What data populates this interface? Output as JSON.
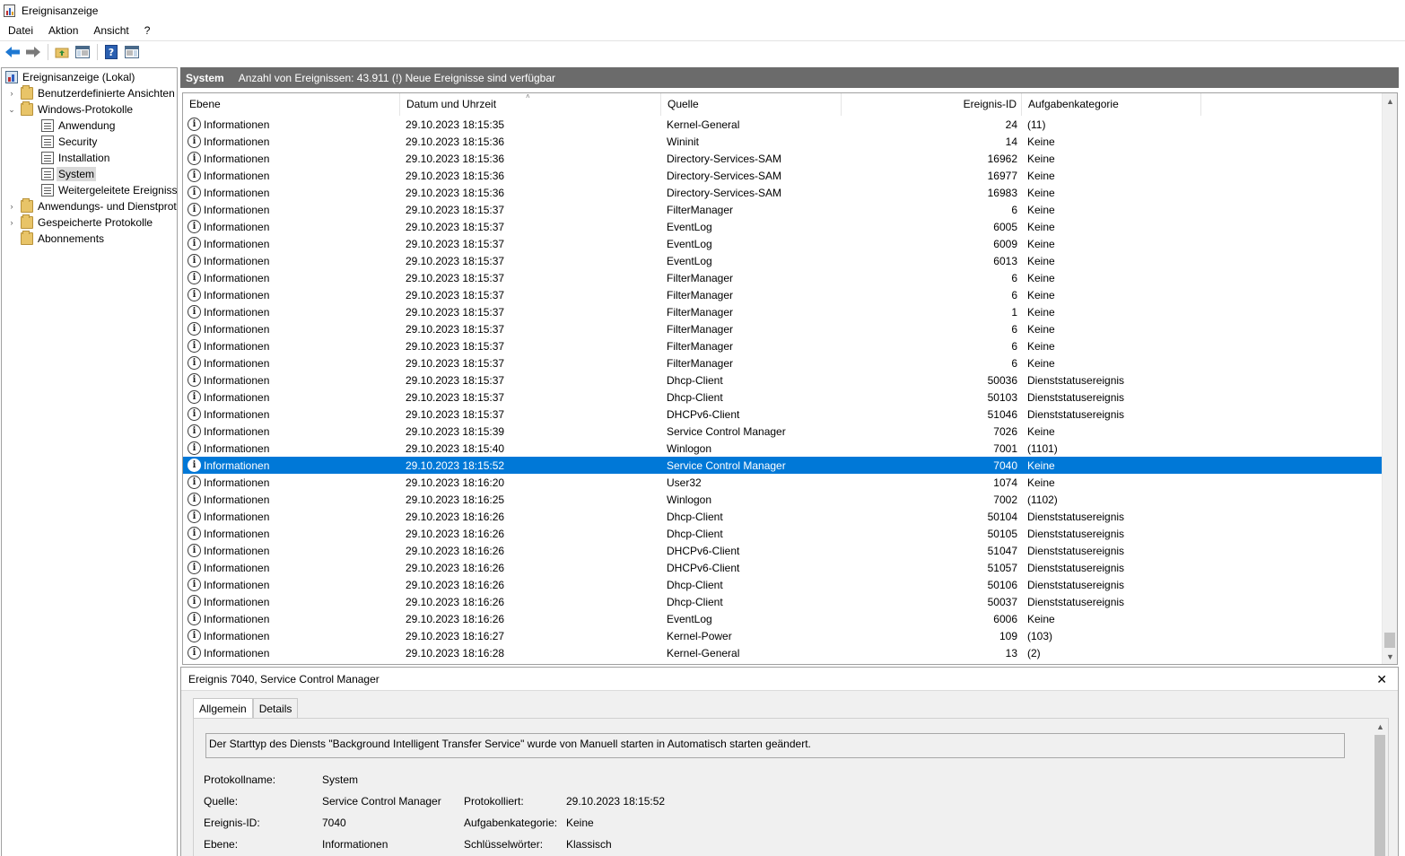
{
  "window": {
    "title": "Ereignisanzeige"
  },
  "menu": [
    {
      "id": "datei",
      "label": "Datei"
    },
    {
      "id": "aktion",
      "label": "Aktion"
    },
    {
      "id": "ansicht",
      "label": "Ansicht"
    },
    {
      "id": "hilfe",
      "label": "?"
    }
  ],
  "toolbar": {
    "buttons": [
      "back-arrow-icon",
      "forward-arrow-icon",
      "folder-up-icon",
      "show-hide-console-tree-icon",
      "help-icon",
      "action-pane-icon"
    ]
  },
  "tree": [
    {
      "label": "Ereignisanzeige (Lokal)",
      "icon": "event-viewer-icon",
      "level": 0,
      "expander": "",
      "selected": false
    },
    {
      "label": "Benutzerdefinierte Ansichten",
      "icon": "folder-icon",
      "level": 1,
      "expander": "collapsed",
      "selected": false
    },
    {
      "label": "Windows-Protokolle",
      "icon": "folder-icon",
      "level": 1,
      "expander": "expanded",
      "selected": false
    },
    {
      "label": "Anwendung",
      "icon": "log-icon",
      "level": 2,
      "expander": "",
      "selected": false
    },
    {
      "label": "Security",
      "icon": "log-icon",
      "level": 2,
      "expander": "",
      "selected": false
    },
    {
      "label": "Installation",
      "icon": "log-icon",
      "level": 2,
      "expander": "",
      "selected": false
    },
    {
      "label": "System",
      "icon": "log-icon",
      "level": 2,
      "expander": "",
      "selected": true
    },
    {
      "label": "Weitergeleitete Ereignisse",
      "icon": "log-icon",
      "level": 2,
      "expander": "",
      "selected": false
    },
    {
      "label": "Anwendungs- und Dienstprotokolle",
      "icon": "folder-icon",
      "level": 1,
      "expander": "collapsed",
      "selected": false
    },
    {
      "label": "Gespeicherte Protokolle",
      "icon": "folder-icon",
      "level": 1,
      "expander": "collapsed",
      "selected": false
    },
    {
      "label": "Abonnements",
      "icon": "folder-icon",
      "level": 1,
      "expander": "",
      "selected": false
    }
  ],
  "main": {
    "log_name": "System",
    "count_text": "Anzahl von Ereignissen: 43.911 (!) Neue Ereignisse sind verfügbar"
  },
  "grid": {
    "columns": [
      "Ebene",
      "Datum und Uhrzeit",
      "Quelle",
      "Ereignis-ID",
      "Aufgabenkategorie"
    ],
    "rows": [
      {
        "level": "Informationen",
        "date": "29.10.2023 18:15:35",
        "source": "Kernel-General",
        "id": "24",
        "category": "(11)"
      },
      {
        "level": "Informationen",
        "date": "29.10.2023 18:15:36",
        "source": "Wininit",
        "id": "14",
        "category": "Keine"
      },
      {
        "level": "Informationen",
        "date": "29.10.2023 18:15:36",
        "source": "Directory-Services-SAM",
        "id": "16962",
        "category": "Keine"
      },
      {
        "level": "Informationen",
        "date": "29.10.2023 18:15:36",
        "source": "Directory-Services-SAM",
        "id": "16977",
        "category": "Keine"
      },
      {
        "level": "Informationen",
        "date": "29.10.2023 18:15:36",
        "source": "Directory-Services-SAM",
        "id": "16983",
        "category": "Keine"
      },
      {
        "level": "Informationen",
        "date": "29.10.2023 18:15:37",
        "source": "FilterManager",
        "id": "6",
        "category": "Keine"
      },
      {
        "level": "Informationen",
        "date": "29.10.2023 18:15:37",
        "source": "EventLog",
        "id": "6005",
        "category": "Keine"
      },
      {
        "level": "Informationen",
        "date": "29.10.2023 18:15:37",
        "source": "EventLog",
        "id": "6009",
        "category": "Keine"
      },
      {
        "level": "Informationen",
        "date": "29.10.2023 18:15:37",
        "source": "EventLog",
        "id": "6013",
        "category": "Keine"
      },
      {
        "level": "Informationen",
        "date": "29.10.2023 18:15:37",
        "source": "FilterManager",
        "id": "6",
        "category": "Keine"
      },
      {
        "level": "Informationen",
        "date": "29.10.2023 18:15:37",
        "source": "FilterManager",
        "id": "6",
        "category": "Keine"
      },
      {
        "level": "Informationen",
        "date": "29.10.2023 18:15:37",
        "source": "FilterManager",
        "id": "1",
        "category": "Keine"
      },
      {
        "level": "Informationen",
        "date": "29.10.2023 18:15:37",
        "source": "FilterManager",
        "id": "6",
        "category": "Keine"
      },
      {
        "level": "Informationen",
        "date": "29.10.2023 18:15:37",
        "source": "FilterManager",
        "id": "6",
        "category": "Keine"
      },
      {
        "level": "Informationen",
        "date": "29.10.2023 18:15:37",
        "source": "FilterManager",
        "id": "6",
        "category": "Keine"
      },
      {
        "level": "Informationen",
        "date": "29.10.2023 18:15:37",
        "source": "Dhcp-Client",
        "id": "50036",
        "category": "Dienststatusereignis"
      },
      {
        "level": "Informationen",
        "date": "29.10.2023 18:15:37",
        "source": "Dhcp-Client",
        "id": "50103",
        "category": "Dienststatusereignis"
      },
      {
        "level": "Informationen",
        "date": "29.10.2023 18:15:37",
        "source": "DHCPv6-Client",
        "id": "51046",
        "category": "Dienststatusereignis"
      },
      {
        "level": "Informationen",
        "date": "29.10.2023 18:15:39",
        "source": "Service Control Manager",
        "id": "7026",
        "category": "Keine"
      },
      {
        "level": "Informationen",
        "date": "29.10.2023 18:15:40",
        "source": "Winlogon",
        "id": "7001",
        "category": "(1101)"
      },
      {
        "level": "Informationen",
        "date": "29.10.2023 18:15:52",
        "source": "Service Control Manager",
        "id": "7040",
        "category": "Keine",
        "selected": true
      },
      {
        "level": "Informationen",
        "date": "29.10.2023 18:16:20",
        "source": "User32",
        "id": "1074",
        "category": "Keine"
      },
      {
        "level": "Informationen",
        "date": "29.10.2023 18:16:25",
        "source": "Winlogon",
        "id": "7002",
        "category": "(1102)"
      },
      {
        "level": "Informationen",
        "date": "29.10.2023 18:16:26",
        "source": "Dhcp-Client",
        "id": "50104",
        "category": "Dienststatusereignis"
      },
      {
        "level": "Informationen",
        "date": "29.10.2023 18:16:26",
        "source": "Dhcp-Client",
        "id": "50105",
        "category": "Dienststatusereignis"
      },
      {
        "level": "Informationen",
        "date": "29.10.2023 18:16:26",
        "source": "DHCPv6-Client",
        "id": "51047",
        "category": "Dienststatusereignis"
      },
      {
        "level": "Informationen",
        "date": "29.10.2023 18:16:26",
        "source": "DHCPv6-Client",
        "id": "51057",
        "category": "Dienststatusereignis"
      },
      {
        "level": "Informationen",
        "date": "29.10.2023 18:16:26",
        "source": "Dhcp-Client",
        "id": "50106",
        "category": "Dienststatusereignis"
      },
      {
        "level": "Informationen",
        "date": "29.10.2023 18:16:26",
        "source": "Dhcp-Client",
        "id": "50037",
        "category": "Dienststatusereignis"
      },
      {
        "level": "Informationen",
        "date": "29.10.2023 18:16:26",
        "source": "EventLog",
        "id": "6006",
        "category": "Keine"
      },
      {
        "level": "Informationen",
        "date": "29.10.2023 18:16:27",
        "source": "Kernel-Power",
        "id": "109",
        "category": "(103)"
      },
      {
        "level": "Informationen",
        "date": "29.10.2023 18:16:28",
        "source": "Kernel-General",
        "id": "13",
        "category": "(2)"
      }
    ]
  },
  "detail": {
    "title": "Ereignis 7040, Service Control Manager",
    "tabs": [
      {
        "label": "Allgemein",
        "active": true
      },
      {
        "label": "Details",
        "active": false
      }
    ],
    "message": "Der Starttyp des Diensts \"Background Intelligent Transfer Service\" wurde von Manuell starten in Automatisch starten geändert.",
    "fields": {
      "protokollname_label": "Protokollname:",
      "protokollname_value": "System",
      "quelle_label": "Quelle:",
      "quelle_value": "Service Control Manager",
      "protokolliert_label": "Protokolliert:",
      "protokolliert_value": "29.10.2023 18:15:52",
      "ereignis_id_label": "Ereignis-ID:",
      "ereignis_id_value": "7040",
      "aufgabenkategorie_label": "Aufgabenkategorie:",
      "aufgabenkategorie_value": "Keine",
      "ebene_label": "Ebene:",
      "ebene_value": "Informationen",
      "schluesselwoerter_label": "Schlüsselwörter:",
      "schluesselwoerter_value": "Klassisch"
    }
  },
  "colors": {
    "selection": "#0078d7",
    "header_bar": "#6b6b6b",
    "back_arrow": "#1e78d2"
  }
}
